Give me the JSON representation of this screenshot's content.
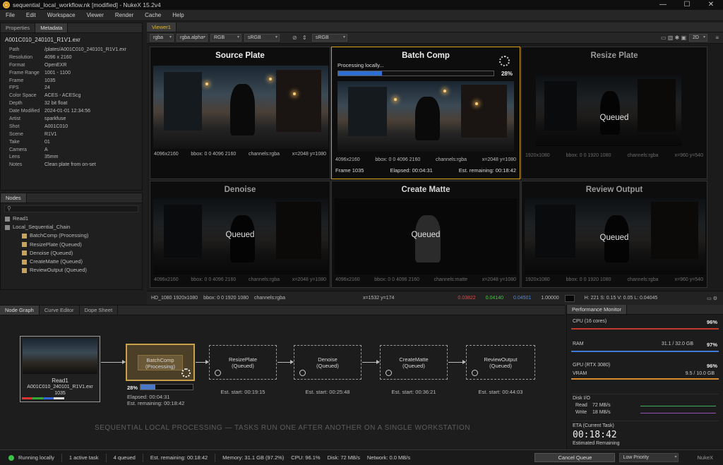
{
  "window": {
    "title": "sequential_local_workflow.nk [modified] - NukeX 15.2v4",
    "controls": [
      "—",
      "☐",
      "✕"
    ]
  },
  "menu": [
    "File",
    "Edit",
    "Workspace",
    "Viewer",
    "Render",
    "Cache",
    "Help"
  ],
  "properties_panel": {
    "tabs": [
      "Properties",
      "Metadata"
    ],
    "file": "A001C010_240101_R1V1.exr",
    "rows": [
      {
        "k": "Path",
        "v": "/plates/A001C010_240101_R1V1.exr"
      },
      {
        "k": "Resolution",
        "v": "4096 x 2160"
      },
      {
        "k": "Format",
        "v": "OpenEXR"
      },
      {
        "k": "Frame Range",
        "v": "1001 - 1100"
      },
      {
        "k": "Frame",
        "v": "1035"
      },
      {
        "k": "FPS",
        "v": "24"
      },
      {
        "k": "Color Space",
        "v": "ACES - ACEScg"
      },
      {
        "k": "Depth",
        "v": "32 bit float"
      },
      {
        "k": "Date Modified",
        "v": "2024-01-01 12:34:56"
      },
      {
        "k": "Artist",
        "v": "sparkfuse"
      },
      {
        "k": "Shot",
        "v": "A001C010"
      },
      {
        "k": "Scene",
        "v": "R1V1"
      },
      {
        "k": "Take",
        "v": "01"
      },
      {
        "k": "Camera",
        "v": "A"
      },
      {
        "k": "Lens",
        "v": "35mm"
      },
      {
        "k": "Notes",
        "v": "Clean plate from on-set"
      }
    ]
  },
  "nodes_panel": {
    "tab": "Nodes",
    "search_placeholder": "",
    "tree": [
      "Read1",
      "Local_Sequential_Chain",
      "BatchComp (Processing)",
      "ResizePlate (Queued)",
      "Denoise (Queued)",
      "CreateMatte (Queued)",
      "ReviewOutput (Queued)"
    ]
  },
  "viewer": {
    "tab": "Viewer1",
    "toolbar": {
      "channels": "rgba",
      "alpha": "rgba.alpha",
      "mode": "RGB",
      "lut": "sRGB",
      "lut2": "sRGB",
      "view": "2D"
    },
    "tiles": [
      {
        "title": "Source Plate",
        "res": "4096x2160",
        "bbox": "bbox: 0 0 4096 2160",
        "ch": "channels:rgba",
        "xy": "x=2048 y=1080"
      },
      {
        "title": "Batch Comp",
        "status": "Processing locally...",
        "progress": 28,
        "pct": "28%",
        "res": "4096x2160",
        "bbox": "bbox: 0 0 4096 2160",
        "ch": "channels:rgba",
        "xy": "x=2048 y=1080",
        "frame": "Frame 1035",
        "elapsed": "Elapsed: 00:04:31",
        "remaining": "Est. remaining: 00:18:42"
      },
      {
        "title": "Resize Plate",
        "queued": "Queued",
        "res": "1920x1080",
        "bbox": "bbox: 0 0 1920 1080",
        "ch": "channels:rgba",
        "xy": "x=960 y=540"
      },
      {
        "title": "Denoise",
        "queued": "Queued",
        "res": "4096x2160",
        "bbox": "bbox: 0 0 4096 2160",
        "ch": "channels:rgba",
        "xy": "x=2048 y=1080"
      },
      {
        "title": "Create Matte",
        "queued": "Queued",
        "res": "4096x2160",
        "bbox": "bbox: 0 0 4096 2160",
        "ch": "channels:matte",
        "xy": "x=2048 y=1080"
      },
      {
        "title": "Review Output",
        "queued": "Queued",
        "res": "1920x1080",
        "bbox": "bbox: 0 0 1920 1080",
        "ch": "channels:rgba",
        "xy": "x=960 y=540"
      }
    ],
    "status": {
      "format": "HD_1080 1920x1080",
      "bbox": "bbox: 0 0 1920 1080",
      "ch": "channels:rgba",
      "xy": "x=1532 y=174",
      "r": "0.03822",
      "g": "0.04140",
      "b": "0.04501",
      "a": "1.00000",
      "hsvl": "H: 221  S: 0.15  V: 0.05  L: 0.04045"
    }
  },
  "graph": {
    "tabs": [
      "Node Graph",
      "Curve Editor",
      "Dope Sheet"
    ],
    "read": {
      "name": "Read1",
      "file": "A001C010_240101_R1V1.exr",
      "frame": "1035"
    },
    "processing": {
      "name": "BatchComp",
      "state": "(Processing)",
      "pct": "28%",
      "progress": 28,
      "elapsed": "Elapsed: 00:04:31",
      "remaining": "Est. remaining: 00:18:42"
    },
    "queued": [
      {
        "name": "ResizePlate",
        "state": "(Queued)",
        "est": "Est. start: 00:19:15"
      },
      {
        "name": "Denoise",
        "state": "(Queued)",
        "est": "Est. start: 00:25:48"
      },
      {
        "name": "CreateMatte",
        "state": "(Queued)",
        "est": "Est. start: 00:36:21"
      },
      {
        "name": "ReviewOutput",
        "state": "(Queued)",
        "est": "Est. start: 00:44:03"
      }
    ],
    "caption": "SEQUENTIAL LOCAL PROCESSING — TASKS RUN ONE AFTER ANOTHER ON A SINGLE WORKSTATION"
  },
  "perf": {
    "tab": "Performance Monitor",
    "cpu": {
      "label": "CPU (16 cores)",
      "pct": "96%",
      "color": "#c0392b"
    },
    "ram": {
      "label": "RAM",
      "val": "31.1 / 32.0 GB",
      "pct": "97%",
      "color": "#3e7bd6"
    },
    "gpu": {
      "label": "GPU (RTX 3080)",
      "pct": "96%",
      "vram": "VRAM",
      "vram_val": "9.5 / 10.0 GB",
      "color": "#d98b2b"
    },
    "disk": {
      "label": "Disk I/O",
      "read": "Read",
      "read_val": "72 MB/s",
      "write": "Write",
      "write_val": "18 MB/s"
    },
    "eta": {
      "label": "ETA (Current Task)",
      "value": "00:18:42",
      "sub": "Estimated Remaining"
    }
  },
  "statusbar": {
    "running": "Running locally",
    "active": "1 active task",
    "queued": "4 queued",
    "remaining": "Est. remaining: 00:18:42",
    "memory": "Memory: 31.1 GB (97.2%)",
    "cpu": "CPU: 96.1%",
    "disk": "Disk: 72 MB/s",
    "network": "Network: 0.0 MB/s",
    "cancel": "Cancel Queue",
    "priority": "Low Priority",
    "brand": "NukeX"
  }
}
